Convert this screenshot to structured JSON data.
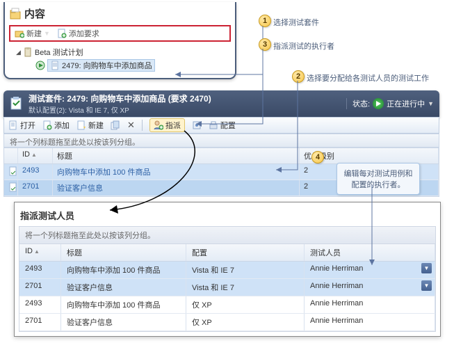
{
  "top": {
    "title": "内容",
    "new_label": "新建",
    "add_req_label": "添加要求",
    "plan_label": "Beta 测试计划",
    "suite_label": "2479: 向购物车中添加商品"
  },
  "suite": {
    "title": "测试套件: 2479: 向购物车中添加商品 (要求 2470)",
    "config": "默认配置(2): Vista 和 IE 7, 仅 XP",
    "status_label": "状态:",
    "status_value": "正在进行中"
  },
  "tb2": {
    "open": "打开",
    "add": "添加",
    "new": "新建",
    "assign": "指派",
    "config": "配置"
  },
  "group_hint": "将一个列标题拖至此处以按该列分组。",
  "table1": {
    "cols": {
      "id": "ID",
      "title": "标题",
      "priority": "优先级别"
    },
    "rows": [
      {
        "id": "2493",
        "title": "向购物车中添加 100 件商品",
        "priority": "2"
      },
      {
        "id": "2701",
        "title": "验证客户信息",
        "priority": "2"
      }
    ]
  },
  "assign": {
    "title": "指派测试人员",
    "hint": "将一个列标题拖至此处以按该列分组。",
    "cols": {
      "id": "ID",
      "title": "标题",
      "config": "配置",
      "tester": "测试人员"
    },
    "rows": [
      {
        "id": "2493",
        "title": "向购物车中添加 100 件商品",
        "config": "Vista 和 IE 7",
        "tester": "Annie Herriman",
        "selected": true
      },
      {
        "id": "2701",
        "title": "验证客户信息",
        "config": "Vista 和 IE 7",
        "tester": "Annie Herriman",
        "selected": true
      },
      {
        "id": "2493",
        "title": "向购物车中添加 100 件商品",
        "config": "仅 XP",
        "tester": "Annie Herriman",
        "selected": false
      },
      {
        "id": "2701",
        "title": "验证客户信息",
        "config": "仅 XP",
        "tester": "Annie Herriman",
        "selected": false
      }
    ]
  },
  "callouts": {
    "c1": "选择测试套件",
    "c2": "选择要分配给各测试人员的测试工作",
    "c3": "指派测试的执行者",
    "c4": "编辑每对测试用例和配置的执行者。"
  }
}
